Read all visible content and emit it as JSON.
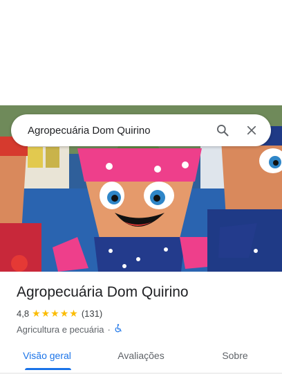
{
  "search": {
    "query": "Agropecuária Dom Quirino"
  },
  "icons": {
    "search": "search-icon",
    "close": "close-icon",
    "accessibility": "wheelchair-icon",
    "star": "star-icon"
  },
  "place": {
    "name": "Agropecuária Dom Quirino",
    "rating": "4,8",
    "stars": "★★★★★",
    "reviews": "(131)",
    "category": "Agricultura e pecuária",
    "separator": "·"
  },
  "tabs": [
    {
      "label": "Visão geral",
      "active": true
    },
    {
      "label": "Avaliações",
      "active": false
    },
    {
      "label": "Sobre",
      "active": false
    }
  ],
  "colors": {
    "accent": "#1a73e8",
    "star": "#fbbc04",
    "text": "#202124"
  }
}
